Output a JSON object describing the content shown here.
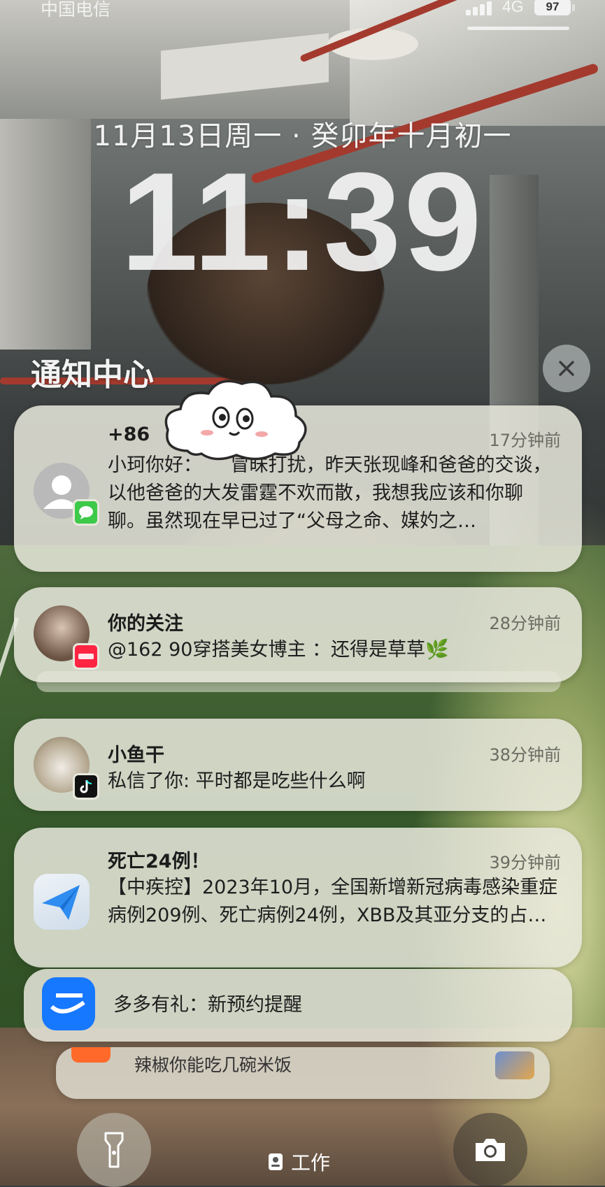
{
  "status_bar": {
    "carrier": "中国电信",
    "network": "4G",
    "battery": "97"
  },
  "lock_screen": {
    "date": "11月13日周一 · 癸卯年十月初一",
    "time": "11:39"
  },
  "notification_center": {
    "title": "通知中心"
  },
  "notifications": [
    {
      "app": "messages-icon",
      "title": "+86",
      "time": "17分钟前",
      "body": "小珂你好：　　冒昧打扰，昨天张现峰和爸爸的交谈，以他爸爸的大发雷霆不欢而散，我想我应该和你聊聊。虽然现在早已过了“父母之命、媒妁之…"
    },
    {
      "app": "xiaohongshu-icon",
      "title": "你的关注",
      "time": "28分钟前",
      "body": "@162 90穿搭美女博主 ：还得是草草🌿"
    },
    {
      "app": "tiktok-icon",
      "title": "小鱼干",
      "time": "38分钟前",
      "body": "私信了你: 平时都是吃些什么啊"
    },
    {
      "app": "send-icon",
      "title": "死亡24例！",
      "time": "39分钟前",
      "body": "【中疾控】2023年10月，全国新增新冠病毒感染重症病例209例、死亡病例24例，XBB及其亚分支的占…"
    },
    {
      "app": "alipay-icon",
      "title": "",
      "time": "",
      "body": "多多有礼：新预约提醒"
    },
    {
      "app": "food-icon",
      "title": "",
      "time": "",
      "body": "辣椒你能吃几碗米饭"
    }
  ],
  "bottom": {
    "focus_label": "工作"
  }
}
